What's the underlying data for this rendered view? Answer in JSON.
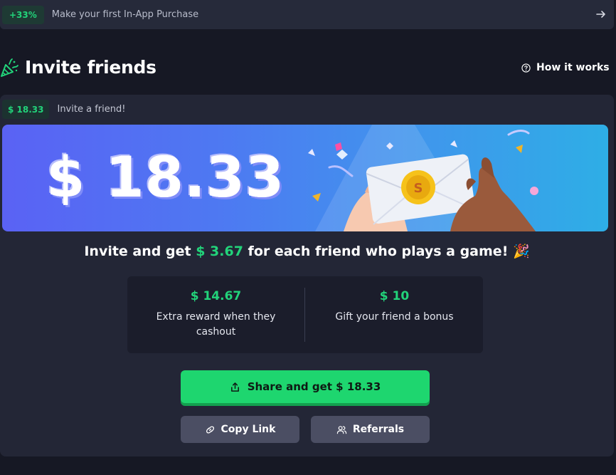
{
  "promo": {
    "badge": "+33%",
    "text": "Make your first In-App Purchase"
  },
  "header": {
    "title": "Invite friends",
    "how_it_works": "How it works"
  },
  "reward": {
    "badge": "$ 18.33",
    "text": "Invite a friend!"
  },
  "banner": {
    "amount": "$ 18.33"
  },
  "headline": {
    "prefix": "Invite and get",
    "amount": "$ 3.67",
    "suffix": "for each friend who plays a game! 🎉"
  },
  "stats": [
    {
      "value": "$ 14.67",
      "desc": "Extra reward when they cashout"
    },
    {
      "value": "$ 10",
      "desc": "Gift your friend a bonus"
    }
  ],
  "buttons": {
    "share": "Share and get $ 18.33",
    "copy_link": "Copy Link",
    "referrals": "Referrals"
  },
  "colors": {
    "accent_green": "#1ed66f",
    "background": "#161824",
    "card": "#232636"
  },
  "icons": {
    "promo_arrow": "arrow-right-icon",
    "title_icon": "party-popper-icon",
    "how_it_works": "question-circle-icon",
    "share": "share-icon",
    "copy": "link-icon",
    "referrals": "users-icon"
  }
}
